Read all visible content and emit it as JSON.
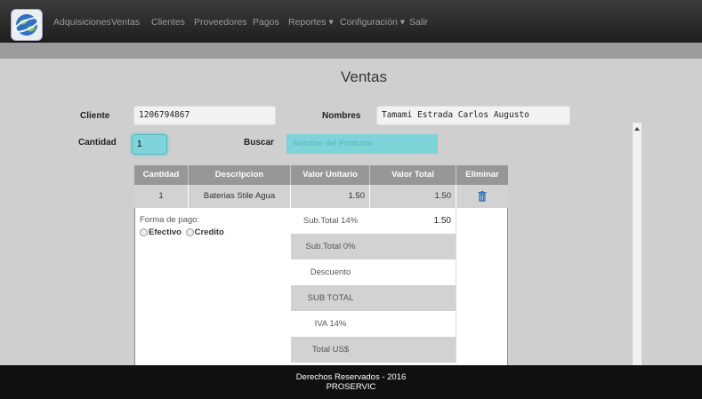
{
  "navbar": {
    "items": [
      "Adquisiciones",
      "Ventas",
      "Clientes",
      "Proveedores",
      "Pagos",
      "Reportes ▾",
      "Configuración ▾",
      "Salir"
    ]
  },
  "page": {
    "title": "Ventas"
  },
  "form": {
    "cliente_label": "Cliente",
    "cliente_value": "1206794867",
    "nombres_label": "Nombres",
    "nombres_value": "Tamami Estrada Carlos Augusto",
    "cantidad_label": "Cantidad",
    "cantidad_value": "1",
    "buscar_label": "Buscar",
    "buscar_placeholder": "Nombre del Producto"
  },
  "table": {
    "headers": [
      "Cantidad",
      "Descripcion",
      "Valor Unitario",
      "Valor Total",
      "Eliminar"
    ],
    "rows": [
      {
        "cantidad": "1",
        "descripcion": "Baterias Stile Agua",
        "unitario": "1.50",
        "total": "1.50",
        "eliminar_icon": "trash-icon"
      }
    ]
  },
  "payment": {
    "label": "Forma de pago:",
    "options": [
      "Efectivo",
      "Credito"
    ]
  },
  "summary": [
    {
      "label": "Sub.Total 14%",
      "value": "1.50"
    },
    {
      "label": "Sub.Total 0%",
      "value": ""
    },
    {
      "label": "Descuento",
      "value": ""
    },
    {
      "label": "SUB TOTAL",
      "value": ""
    },
    {
      "label": "IVA 14%",
      "value": ""
    },
    {
      "label": "Total US$",
      "value": ""
    }
  ],
  "footer": {
    "line1": "Derechos Reservados - 2016",
    "line2": "PROSERVIC"
  },
  "colors": {
    "navbar": "#222222",
    "accent": "#7fd4d9",
    "header": "#979797"
  }
}
